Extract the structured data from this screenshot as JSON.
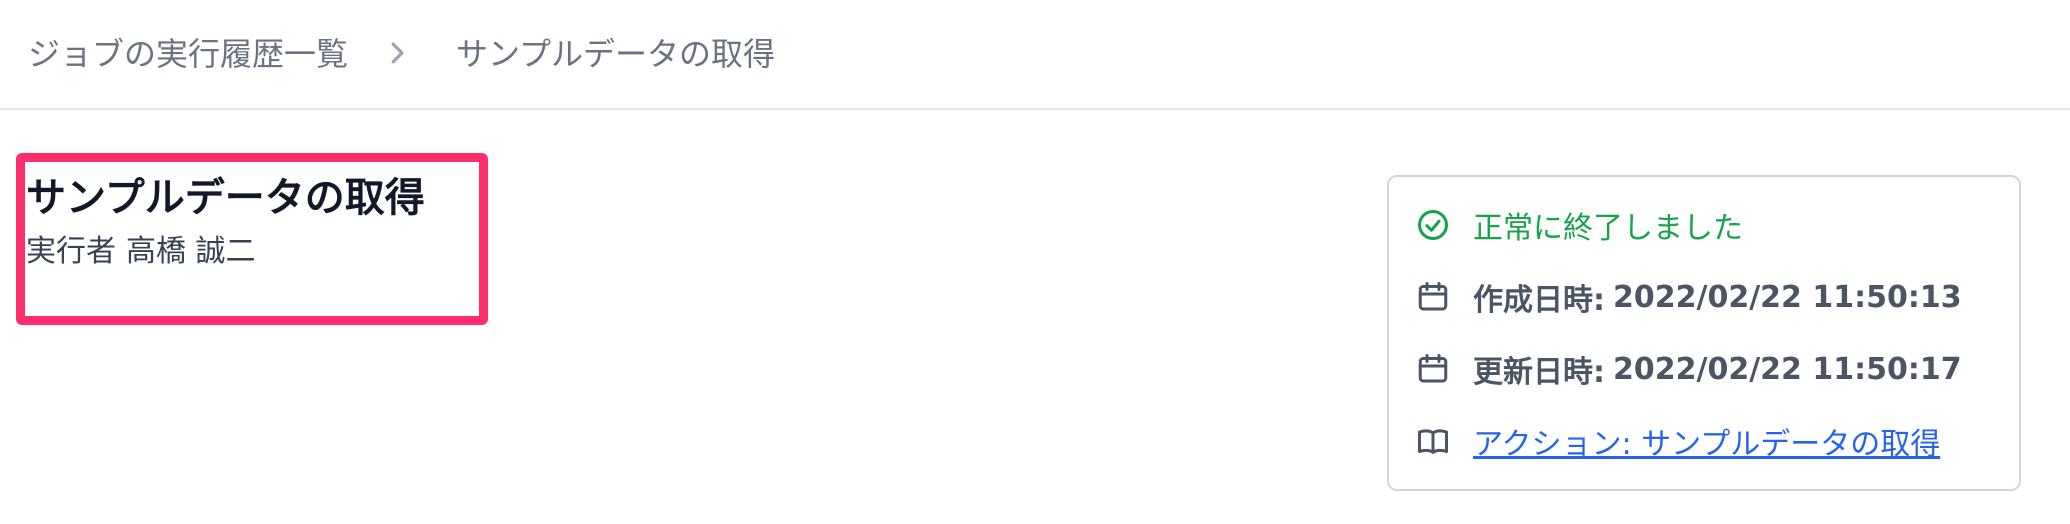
{
  "breadcrumb": {
    "parent": "ジョブの実行履歴一覧",
    "current": "サンプルデータの取得"
  },
  "job": {
    "title": "サンプルデータの取得",
    "executor_label": "実行者",
    "executor_name": "高橋 誠二"
  },
  "info": {
    "status": "正常に終了しました",
    "created_label": "作成日時:",
    "created_value": "2022/02/22 11:50:13",
    "updated_label": "更新日時:",
    "updated_value": "2022/02/22 11:50:17",
    "action_link": "アクション: サンプルデータの取得"
  },
  "icons": {
    "separator": "chevron-right-icon",
    "status": "check-circle-icon",
    "created": "calendar-icon",
    "updated": "calendar-icon",
    "action": "book-icon"
  },
  "colors": {
    "highlight": "#ff2f6d",
    "success": "#16a34a",
    "link": "#2563eb",
    "muted": "#6b7280"
  }
}
